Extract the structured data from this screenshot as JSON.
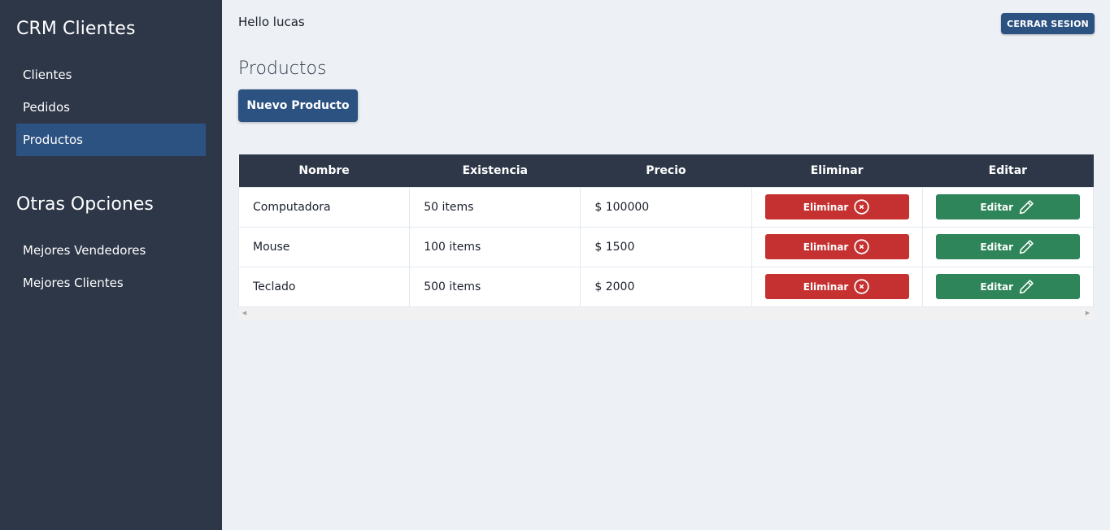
{
  "sidebar": {
    "brand": "CRM Clientes",
    "items": [
      {
        "label": "Clientes"
      },
      {
        "label": "Pedidos"
      },
      {
        "label": "Productos"
      }
    ],
    "section_title": "Otras Opciones",
    "other_items": [
      {
        "label": "Mejores Vendedores"
      },
      {
        "label": "Mejores Clientes"
      }
    ]
  },
  "header": {
    "greeting": "Hello lucas",
    "logout_label": "CERRAR SESION"
  },
  "main": {
    "title": "Productos",
    "new_button": "Nuevo Producto"
  },
  "table": {
    "headers": [
      "Nombre",
      "Existencia",
      "Precio",
      "Eliminar",
      "Editar"
    ],
    "rows": [
      {
        "nombre": "Computadora",
        "existencia": "50 items",
        "precio": "$ 100000",
        "eliminar": "Eliminar",
        "editar": "Editar"
      },
      {
        "nombre": "Mouse",
        "existencia": "100 items",
        "precio": "$ 1500",
        "eliminar": "Eliminar",
        "editar": "Editar"
      },
      {
        "nombre": "Teclado",
        "existencia": "500 items",
        "precio": "$ 2000",
        "eliminar": "Eliminar",
        "editar": "Editar"
      }
    ]
  },
  "colors": {
    "sidebar_bg": "#2d3748",
    "accent": "#2c5282",
    "delete": "#c53030",
    "edit": "#2f855a"
  },
  "icons": {
    "delete": "x-circle-icon",
    "edit": "pencil-icon"
  }
}
